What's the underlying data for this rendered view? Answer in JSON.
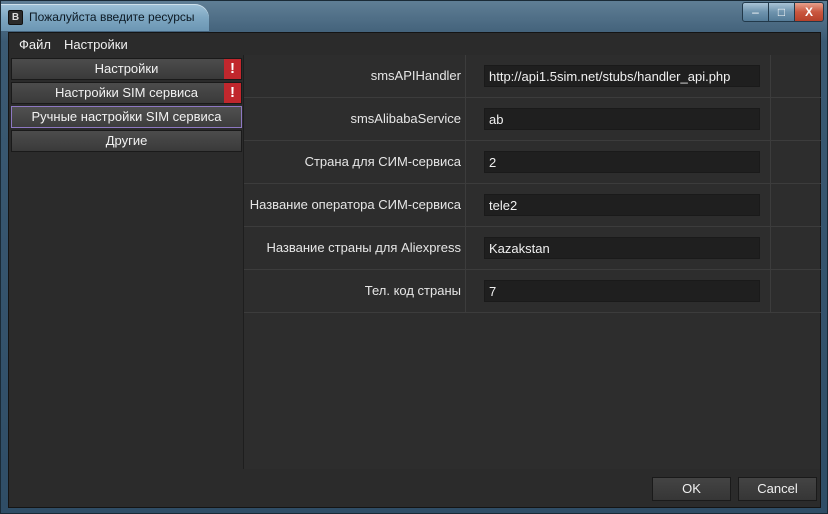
{
  "window": {
    "title": "Пожалуйста введите ресурсы",
    "icon": "B",
    "min_glyph": "–",
    "max_glyph": "□",
    "close_glyph": "X"
  },
  "menu": {
    "file": "Файл",
    "settings": "Настройки"
  },
  "sidebar": {
    "items": [
      {
        "label": "Настройки",
        "warning": "!"
      },
      {
        "label": "Настройки SIM сервиса",
        "warning": "!"
      },
      {
        "label": "Ручные настройки SIM сервиса"
      },
      {
        "label": "Другие"
      }
    ]
  },
  "fields": [
    {
      "label": "smsAPIHandler",
      "value": "http://api1.5sim.net/stubs/handler_api.php"
    },
    {
      "label": "smsAlibabaService",
      "value": "ab"
    },
    {
      "label": "Страна для СИМ-сервиса",
      "value": "2"
    },
    {
      "label": "Название оператора СИМ-сервиса",
      "value": "tele2"
    },
    {
      "label": "Название страны для Aliexpress",
      "value": "Kazakstan"
    },
    {
      "label": "Тел. код страны",
      "value": "7"
    }
  ],
  "buttons": {
    "ok": "OK",
    "cancel": "Cancel"
  },
  "colors": {
    "warning": "#c1272d",
    "active_border": "#8d78c2"
  }
}
